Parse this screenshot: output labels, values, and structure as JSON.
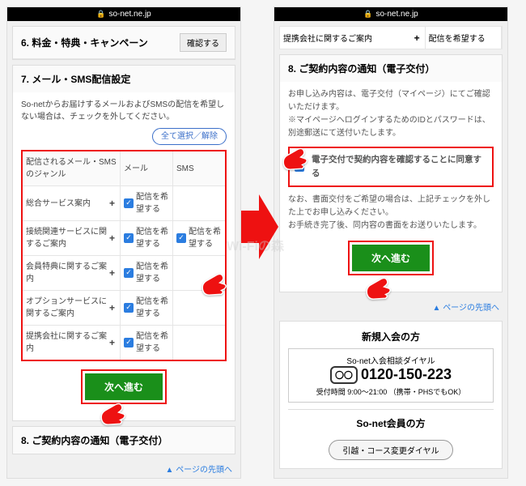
{
  "url": "so-net.ne.jp",
  "left": {
    "sec6": {
      "title": "6. 料金・特典・キャンペーン",
      "confirm": "確認する"
    },
    "sec7": {
      "title": "7. メール・SMS配信設定",
      "desc": "So-netからお届けするメールおよびSMSの配信を希望しない場合は、チェックを外してください。",
      "toggle_all": "全て選択／解除",
      "header": {
        "genre": "配信されるメール・SMSのジャンル",
        "mail": "メール",
        "sms": "SMS"
      },
      "want": "配信を希望する",
      "rows": [
        {
          "label": "総合サービス案内",
          "mail": true,
          "sms": false
        },
        {
          "label": "接続関連サービスに関するご案内",
          "mail": true,
          "sms": true
        },
        {
          "label": "会員特典に関するご案内",
          "mail": true,
          "sms": false
        },
        {
          "label": "オプションサービスに関するご案内",
          "mail": true,
          "sms": false
        },
        {
          "label": "提携会社に関するご案内",
          "mail": true,
          "sms": false
        }
      ],
      "proceed": "次へ進む"
    },
    "sec8": {
      "title": "8. ご契約内容の通知（電子交付）"
    }
  },
  "right": {
    "partner_row": {
      "label": "提携会社に関するご案内",
      "want": "配信を希望する"
    },
    "sec8": {
      "title": "8. ご契約内容の通知（電子交付）",
      "p1": "お申し込み内容は、電子交付（マイページ）にてご確認いただけます。",
      "p2": "※マイページへログインするためのIDとパスワードは、別途郵送にて送付いたします。",
      "agree": "電子交付で契約内容を確認することに同意する",
      "p3": "なお、書面交付をご希望の場合は、上記チェックを外した上でお申し込みください。",
      "p4": "お手続き完了後、同内容の書面をお送りいたします。",
      "proceed": "次へ進む"
    },
    "page_top": "ページの先頭へ",
    "newmember": {
      "title": "新規入会の方",
      "dial_label": "So-net入会相談ダイヤル",
      "freedial": "〇〇",
      "number": "0120-150-223",
      "hours": "受付時間 9:00～21:00 （携帯・PHSでもOK）"
    },
    "member": {
      "title": "So-net会員の方",
      "change": "引越・コース変更ダイヤル"
    }
  },
  "page_top": "ページの先頭へ"
}
